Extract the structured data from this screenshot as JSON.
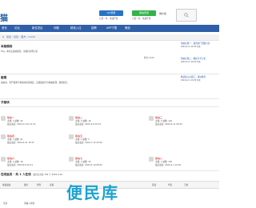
{
  "header": {
    "logo": "猫",
    "qq_button": "QQ登录",
    "qq_sub": "只需一步，快速开始",
    "wx_button": "微信登录",
    "wx_sub": "只需一步，快速开始",
    "user_menu": "用户名",
    "search_icon": "search-icon"
  },
  "nav": {
    "items": [
      "首页",
      "论坛",
      "新住宅区",
      "问题",
      "精选入住",
      "招聘",
      "APP下载",
      "微信"
    ]
  },
  "breadcrumb": {
    "path": "论坛 › 论坛 › 官方 › xxxxx",
    "home_icon": "home-icon"
  },
  "sections": {
    "announce_title": "本版规则",
    "announce_body": "Fitg，本论坛发帖规范，请保持文明讨论",
    "announce_right": "积分 1234",
    "rules_title": "版规",
    "rules_body": "发帖前，请严格遵守本版块各项规定，违规发帖行为将被处理，谢谢配合。",
    "sub_title": "子版块"
  },
  "right_posts": [
    {
      "title": "热帖标题一：最新热门话题讨论",
      "meta": "2024-6-11 16:30 作者"
    },
    {
      "title": "热帖标题二：精彩分享讨论",
      "meta": "2024-6-11 16:30 作者"
    },
    {
      "title": "精选帖子标题三：版块推荐",
      "meta": "2024-6-11 16:30 作者"
    }
  ],
  "forums": [
    {
      "name": "版块一",
      "stats": "主题: 1 帖数: 34",
      "date": "最后发表: 2024-11-22 12:14"
    },
    {
      "name": "版块二",
      "stats": "主题: 1 帖数: 16",
      "date": "最后发表: 2024-4-8 10:21"
    },
    {
      "name": "版块三",
      "stats": "主题: 1 帖数: 191",
      "date": "最后发表: 2024-6-11 09:43"
    },
    {
      "name": "版块四",
      "stats": "主题: 1 帖数: 91",
      "date": "最后发表: 2024-4-21 18:37"
    },
    {
      "name": "版块五",
      "stats": "主题: 1 帖数: 5",
      "date": "最后发表: 2024-7-12 20:40"
    },
    {
      "name": "版块六",
      "stats": "主题: 1 帖数: 78",
      "date": "最后发表: 2024-6-8 10:11"
    },
    {
      "name": "版块七",
      "stats": "主题: 1 帖数: 43",
      "date": "最后发表: 2024-5-19 08:32"
    },
    {
      "name": "版块八",
      "stats": "主题: 1 帖数: 155",
      "date": "最后发表: 2024-4-1 16:20"
    }
  ],
  "online": {
    "title": "在线会员 - 共 1 人在线",
    "stats": "- 最高记录是 769 于 2024-4-16."
  },
  "toolbar": [
    "快速发帖",
    "图片",
    "附件",
    "表情",
    "链接",
    "代码",
    "引用"
  ],
  "bottom": {
    "label": "注意",
    "placeholder": "请输入内容"
  },
  "watermark": "便民库"
}
